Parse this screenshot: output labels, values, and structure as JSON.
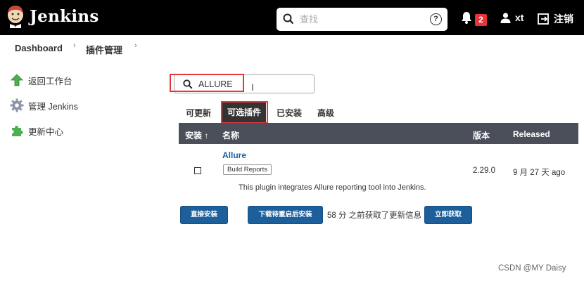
{
  "header": {
    "brand": "Jenkins",
    "search_placeholder": "查找",
    "help_glyph": "?",
    "notification_count": "2",
    "user": "xt",
    "logout_label": "注销"
  },
  "breadcrumb": {
    "items": [
      "Dashboard",
      "插件管理"
    ],
    "separator": "›"
  },
  "sidebar": {
    "items": [
      {
        "label": "返回工作台",
        "icon": "up-arrow-icon"
      },
      {
        "label": "管理 Jenkins",
        "icon": "gear-icon"
      },
      {
        "label": "更新中心",
        "icon": "puzzle-icon"
      }
    ]
  },
  "filter": {
    "value": "ALLURE"
  },
  "tabs": [
    {
      "label": "可更新"
    },
    {
      "label": "可选插件",
      "active": true
    },
    {
      "label": "已安装"
    },
    {
      "label": "高级"
    }
  ],
  "table": {
    "columns": [
      "安装 ↑",
      "名称",
      "版本",
      "Released"
    ],
    "rows": [
      {
        "name": "Allure",
        "tag": "Build Reports",
        "version": "2.29.0",
        "released": "9 月 27 天 ago",
        "description": "This plugin integrates Allure reporting tool into Jenkins."
      }
    ]
  },
  "actions": {
    "install_now": "直接安装",
    "download_restart": "下载待重启后安装",
    "fetched_info": "58 分 之前获取了更新信息",
    "fetch_now": "立即获取"
  },
  "watermark": "CSDN @MY Daisy",
  "colors": {
    "header_bg": "#000000",
    "accent_blue": "#1d5f9a",
    "table_header_bg": "#4a4f59",
    "highlight_red": "#e5353b",
    "badge_red": "#e5353b"
  }
}
